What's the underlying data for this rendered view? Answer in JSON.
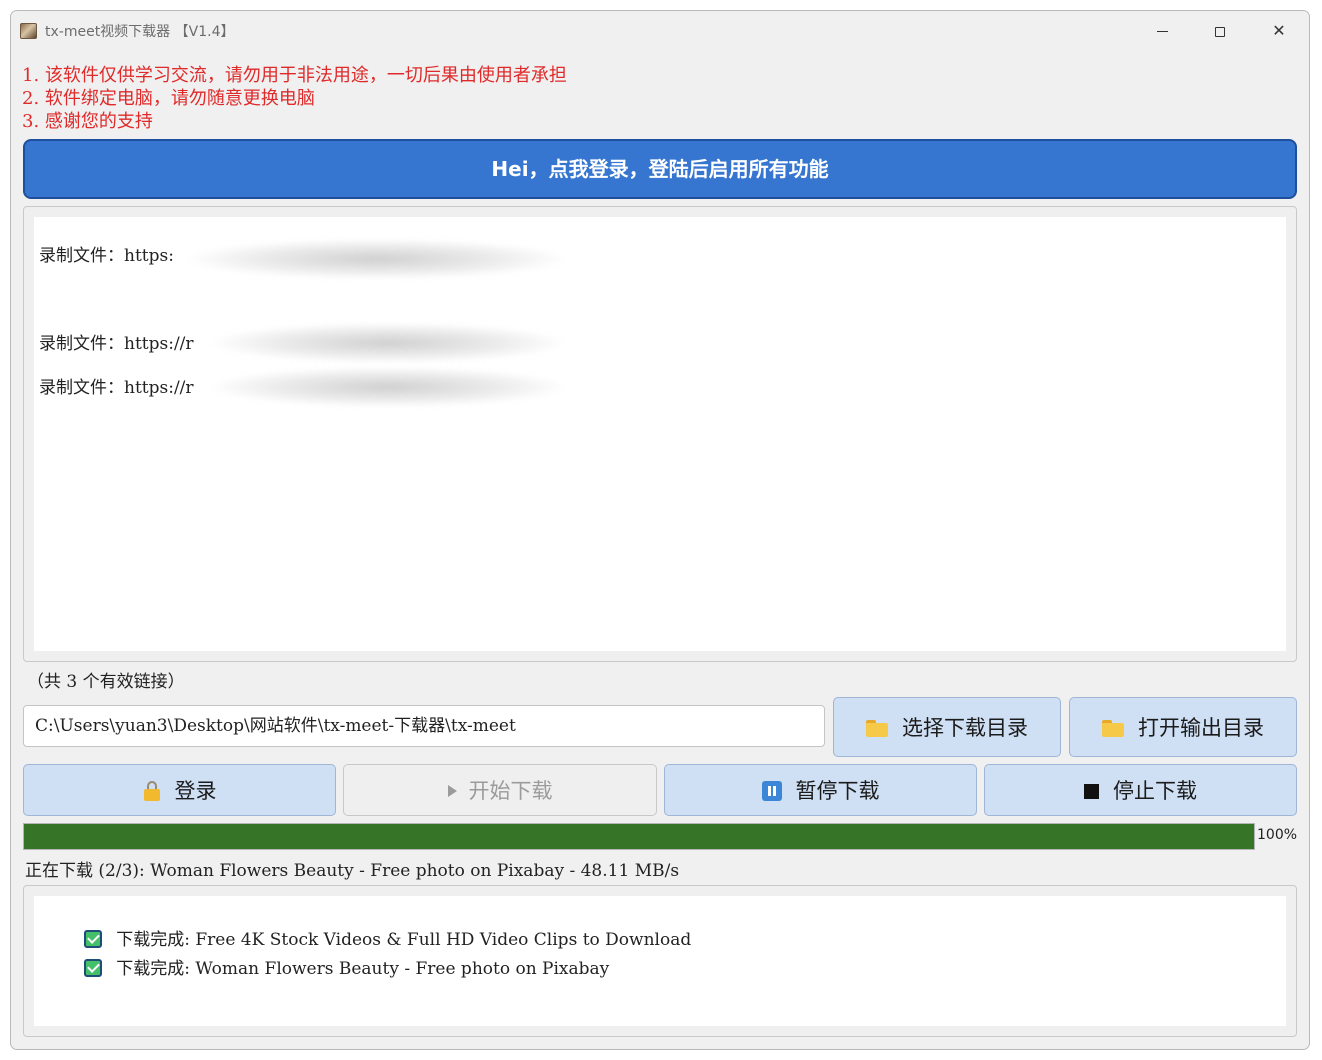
{
  "window": {
    "title": "tx-meet视频下载器 【V1.4】",
    "controls": {
      "minimize": "minimize",
      "maximize": "maximize",
      "close": "✕"
    }
  },
  "notices": [
    "1. 该软件仅供学习交流，请勿用于非法用途，一切后果由使用者承担",
    "2. 软件绑定电脑，请勿随意更换电脑",
    "3. 感谢您的支持"
  ],
  "login_banner": "Hei，点我登录，登陆后启用所有功能",
  "log": {
    "lines": [
      "录制文件：https:",
      "录制文件：https://r",
      "录制文件：https://r"
    ]
  },
  "link_count": "（共 3 个有效链接）",
  "download_path": "C:\\Users\\yuan3\\Desktop\\网站软件\\tx-meet-下载器\\tx-meet",
  "buttons": {
    "choose_dir": "选择下载目录",
    "open_output": "打开输出目录",
    "login": "登录",
    "start": "开始下载",
    "pause": "暂停下载",
    "stop": "停止下载"
  },
  "progress": {
    "value": 1.0,
    "label": "100%",
    "color": "#367527"
  },
  "status": "正在下载 (2/3): Woman Flowers Beauty - Free photo on Pixabay - 48.11 MB/s",
  "completed": [
    "下载完成: Free 4K Stock Videos & Full HD Video Clips to Download",
    "下载完成: Woman Flowers Beauty - Free photo on Pixabay"
  ],
  "colors": {
    "notice": "#e02a2a",
    "banner": "#3676d0",
    "button": "#cfdff4"
  }
}
